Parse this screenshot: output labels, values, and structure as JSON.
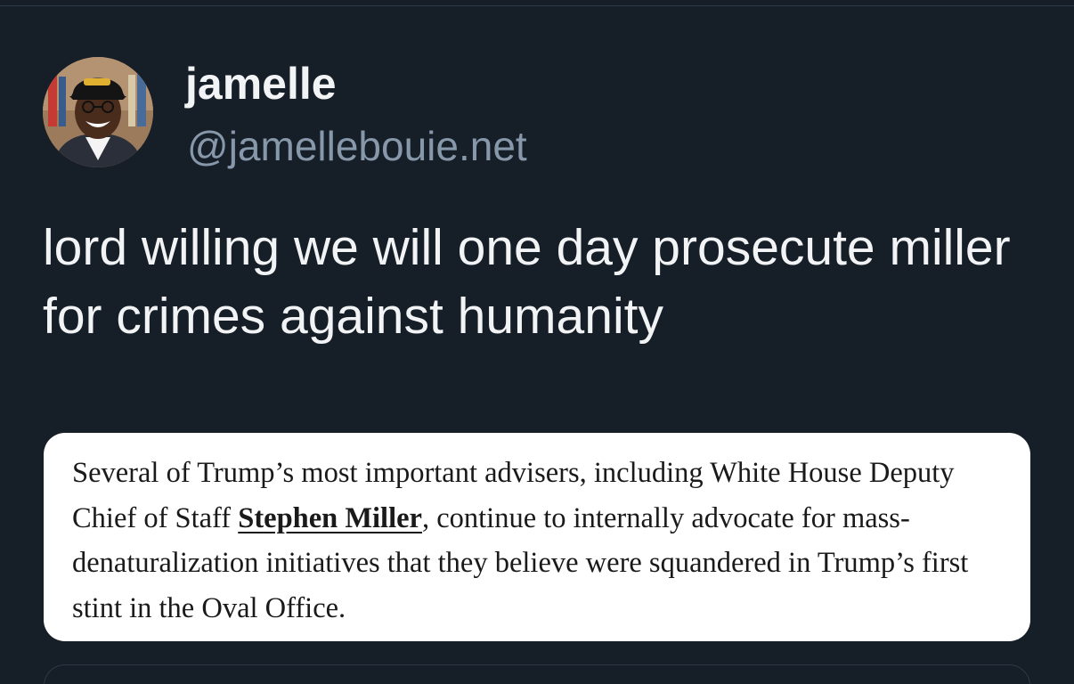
{
  "post": {
    "author": {
      "display_name": "jamelle",
      "handle": "@jamellebouie.net",
      "avatar_icon": "user-avatar-photo"
    },
    "text": "lord willing we will one day prosecute miller for crimes against humanity",
    "image_quote": {
      "text_before": "Several of Trump’s most important advisers, including White House Deputy Chief of Staff ",
      "link_text": "Stephen Miller",
      "text_after": ", continue to internally advocate for mass-denaturalization initiatives that they believe were squandered in Trump’s first stint in the Oval Office."
    }
  },
  "colors": {
    "background": "#161e27",
    "primary_text": "#f1f3f5",
    "secondary_text": "#8798ab",
    "card_background": "#ffffff",
    "card_text": "#1a1a1a"
  }
}
